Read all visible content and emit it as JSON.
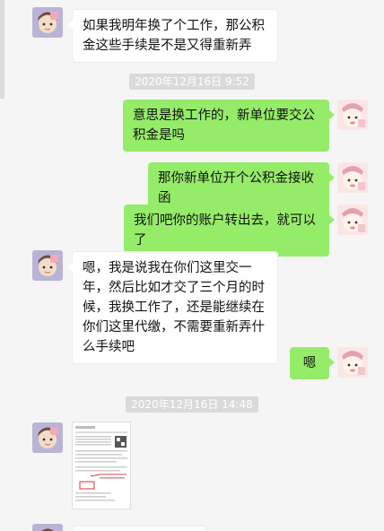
{
  "messages": {
    "m1": "如果我明年换了个工作，那公积金这些手续是不是又得重新弄",
    "t1": "2020年12月16日 9:52",
    "m2": "意思是换工作的，新单位要交公积金是吗",
    "m3": "那你新单位开个公积金接收函",
    "m4": "我们吧你的账户转出去，就可以了",
    "m5": "嗯，我是说我在你们这里交一年，然后比如才交了三个月的时候，我换工作了，还是能继续在你们这里代缴，不需要重新弄什么手续吧",
    "m6": "嗯",
    "t2": "2020年12月16日 14:48"
  },
  "colors": {
    "background": "#f5f5f5",
    "sent_bubble": "#95ec69",
    "received_bubble": "#ffffff",
    "timestamp_bg": "#dadada"
  },
  "icons": {
    "left_avatar": "cartoon-girl-avatar-icon",
    "right_avatar": "cartoon-character-avatar-icon"
  }
}
